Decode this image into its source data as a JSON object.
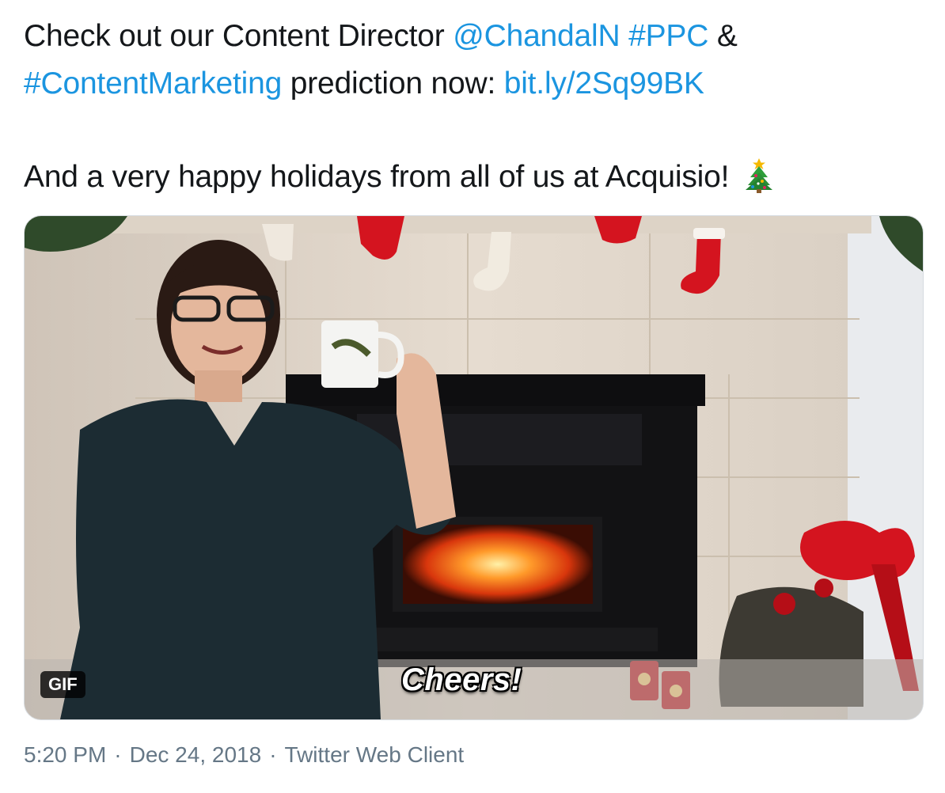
{
  "tweet": {
    "line1": {
      "prefix": "Check out our Content Director ",
      "mention": "@ChandalN",
      "hashtag1": "#PPC",
      "amp": " &"
    },
    "line2": {
      "hashtag2": "#ContentMarketing",
      "middle": " prediction now: ",
      "url": "bit.ly/2Sq99BK"
    },
    "line3": {
      "text": "And a very happy holidays from all of us at Acquisio!",
      "emoji": "christmas-tree-icon"
    }
  },
  "media": {
    "badge": "GIF",
    "caption": "Cheers!"
  },
  "meta": {
    "time": "5:20 PM",
    "separator": "·",
    "date": "Dec 24, 2018",
    "source": "Twitter Web Client"
  },
  "colors": {
    "link": "#1b95e0",
    "text": "#14171a",
    "meta": "#657786"
  }
}
